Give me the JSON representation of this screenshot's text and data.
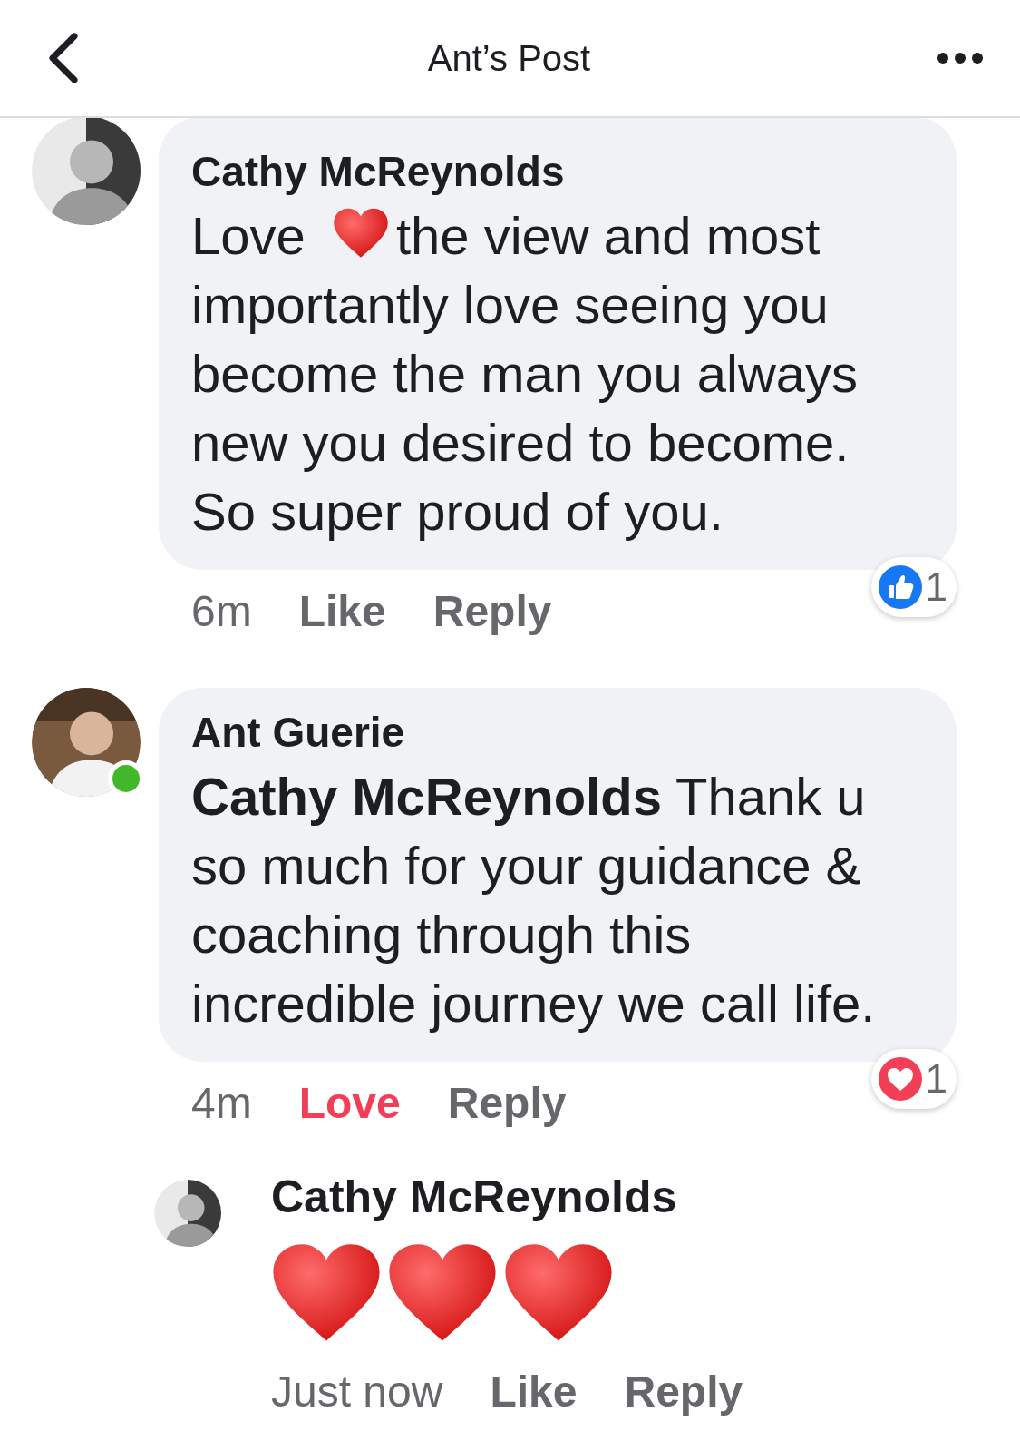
{
  "header": {
    "title": "Ant’s Post"
  },
  "comments": [
    {
      "kind": "comment",
      "author": "Cathy McReynolds",
      "online": false,
      "jumbo": false,
      "body": [
        {
          "kind": "text",
          "text": "Love"
        },
        {
          "kind": "heart"
        },
        {
          "kind": "text",
          "text": "the view and most importantly love seeing you become the man you always new you desired to become. So super proud of you."
        }
      ],
      "time": "6m",
      "actions": [
        {
          "kind": "react",
          "label": "Like",
          "reacted": false
        },
        {
          "kind": "reply",
          "label": "Reply"
        }
      ],
      "reactions": {
        "kind": "like",
        "count": "1"
      }
    },
    {
      "kind": "comment",
      "author": "Ant Guerie",
      "online": true,
      "jumbo": false,
      "body": [
        {
          "kind": "text",
          "text": "**Cathy McReynolds** Thank u so much for your guidance & coaching through this incredible journey we call life."
        }
      ],
      "time": "4m",
      "actions": [
        {
          "kind": "react",
          "label": "Love",
          "reacted": true
        },
        {
          "kind": "reply",
          "label": "Reply"
        }
      ],
      "reactions": {
        "kind": "love",
        "count": "1"
      }
    },
    {
      "kind": "reply",
      "author": "Cathy McReynolds",
      "online": false,
      "jumbo": true,
      "body": [
        {
          "kind": "heart"
        },
        {
          "kind": "heart"
        },
        {
          "kind": "heart"
        }
      ],
      "time": "Just now",
      "actions": [
        {
          "kind": "react",
          "label": "Like",
          "reacted": false
        },
        {
          "kind": "reply",
          "label": "Reply"
        }
      ]
    }
  ]
}
